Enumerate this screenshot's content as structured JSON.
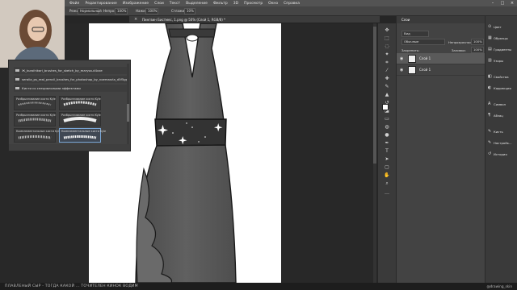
{
  "menu": [
    "Файл",
    "Редактирование",
    "Изображение",
    "Слои",
    "Текст",
    "Выделение",
    "Фильтр",
    "3D",
    "Просмотр",
    "Окно",
    "Справка"
  ],
  "options": {
    "mode_label": "Режим:",
    "mode_value": "Нормальный",
    "opacity_label": "Непрозр.:",
    "opacity_value": "100%",
    "flow_label": "Нажим:",
    "flow_value": "100%",
    "smooth_label": "Сглаживание:",
    "smooth_value": "10%"
  },
  "document": {
    "zoom_prefix": "Ⅱ",
    "title": "Пингвин Бистмес, 1.png @ 50% (Слой 1, RGB/8) *"
  },
  "brush_panel": {
    "rows": [
      "Ж_kuroihikari_brushes_for_sketch_by_marysa-d4xxe",
      "seralia_ps_real_pencil_brushes_for_photoshop_by_noemasrla_d5f5gp4",
      "Кисти со специальными эффектами"
    ],
    "tiles": [
      "Разбрызгивание кисти Kyle",
      "Разбрызгивание кисти Kyle",
      "",
      "Разбрызгивание кисти Kyle",
      "Разбрызгивание кисти Kyle",
      "",
      "Комплементальные кисти Kyle",
      "Комплементальные кисти Kyle",
      "",
      "Особенности Kyle 0l",
      "Особенности Kyle 0l",
      ""
    ]
  },
  "layers_panel": {
    "tab": "Слои",
    "kind_label": "Вид",
    "blend": "Обычные",
    "opacity_label": "Непрозрачность:",
    "opacity_value": "100%",
    "lock_label": "Закрепить:",
    "fill_label": "Заливка:",
    "fill_value": "100%",
    "layers": [
      {
        "name": "Слой 1",
        "selected": true
      },
      {
        "name": "Слой 1",
        "selected": false
      }
    ]
  },
  "right_strip": [
    {
      "icon": "⊙",
      "label": "Цвет"
    },
    {
      "icon": "▦",
      "label": "Образцы"
    },
    {
      "icon": "▤",
      "label": "Градиенты"
    },
    {
      "icon": "▥",
      "label": "Узоры"
    },
    {
      "icon": "◧",
      "label": "Свойства"
    },
    {
      "icon": "◐",
      "label": "Коррекция"
    },
    {
      "icon": "A",
      "label": "Символ"
    },
    {
      "icon": "¶",
      "label": "Абзац"
    },
    {
      "icon": "✎",
      "label": "Кисть"
    },
    {
      "icon": "✎",
      "label": "Настройк..."
    },
    {
      "icon": "↺",
      "label": "История"
    }
  ],
  "caption": {
    "left": "ПЛАВЛЕНЫЙ СЫР - ТОГДА КАКОЙ ... ТОЧИТЕЛЕН КИНОК ВОДИМ",
    "right": "@drawing_skin"
  },
  "colors": {
    "ui_dark": "#262626",
    "panel": "#434343",
    "dress": "#5a5a5a",
    "belt": "#333333"
  }
}
